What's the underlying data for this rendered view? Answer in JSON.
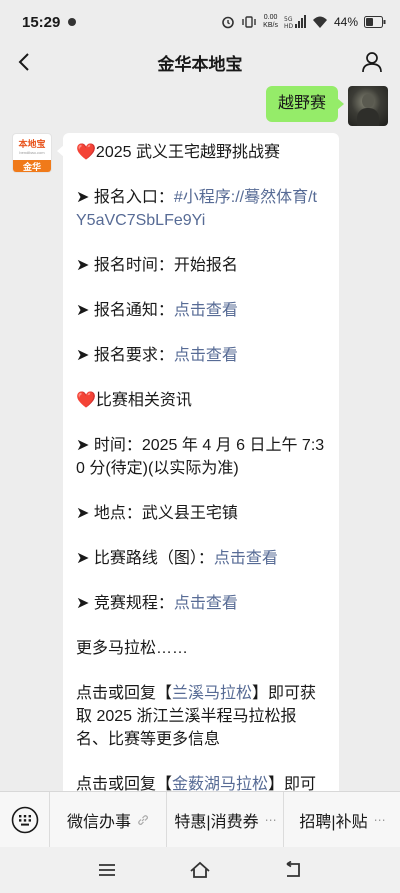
{
  "status": {
    "time": "15:29",
    "net_speed_value": "0.00",
    "net_speed_unit": "KB/s",
    "network": "5G HD",
    "battery": "44%"
  },
  "header": {
    "title": "金华本地宝"
  },
  "sent_message": {
    "text": "越野赛"
  },
  "bot": {
    "logo_text": "本地宝",
    "logo_url": "bendibao.com",
    "logo_city": "金华"
  },
  "message": {
    "title_heart": "❤️",
    "title": "2025 武义王宅越野挑战赛",
    "signup_entry_label": "➤ 报名入口：",
    "signup_entry_link": "#小程序://蓦然体育/tY5aVC7SbLFe9Yi",
    "signup_time": "➤ 报名时间：开始报名",
    "signup_notice_label": "➤ 报名通知：",
    "signup_notice_link": "点击查看",
    "signup_req_label": "➤ 报名要求：",
    "signup_req_link": "点击查看",
    "info_heart": "❤️",
    "info_title": "比赛相关资讯",
    "time": "➤ 时间：2025 年 4 月 6 日上午 7:30 分(待定)(以实际为准)",
    "place": "➤ 地点：武义县王宅镇",
    "route_label": "➤ 比赛路线（图）：",
    "route_link": "点击查看",
    "rules_label": "➤ 竞赛规程：",
    "rules_link": "点击查看",
    "more": "更多马拉松……",
    "reply1_prefix": "点击或回复【",
    "reply1_link": "兰溪马拉松",
    "reply1_suffix": "】即可获取 2025 浙江兰溪半程马拉松报名、比赛等更多信息",
    "reply2_prefix": "点击或回复【",
    "reply2_link": "金薮湖马拉松",
    "reply2_suffix": "】即可"
  },
  "menu": {
    "items": [
      {
        "label": "微信办事",
        "icon": "link-icon"
      },
      {
        "label": "特惠|消费券",
        "icon": "dots"
      },
      {
        "label": "招聘|补贴",
        "icon": "dots"
      }
    ],
    "dots": "⋯"
  }
}
